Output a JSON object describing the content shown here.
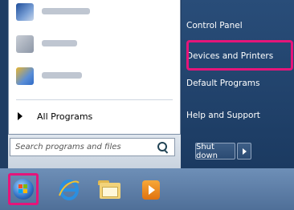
{
  "start_menu": {
    "pinned_programs": [
      {
        "icon": "program-icon-blurred-1"
      },
      {
        "icon": "program-icon-blurred-2"
      },
      {
        "icon": "program-icon-blurred-3"
      }
    ],
    "all_programs_label": "All Programs",
    "search_placeholder": "Search programs and files",
    "right_items": [
      "Control Panel",
      "Devices and Printers",
      "Default Programs",
      "Help and Support"
    ],
    "highlighted_item": "Devices and Printers",
    "shutdown_label": "Shut down"
  },
  "taskbar": {
    "start_button_icon": "windows-orb-icon",
    "pinned": [
      "internet-explorer-icon",
      "windows-explorer-icon",
      "media-player-icon"
    ]
  },
  "colors": {
    "highlight": "#e5157a",
    "menu_right_bg": "#1f3d63",
    "taskbar": "#5b7ba4"
  }
}
